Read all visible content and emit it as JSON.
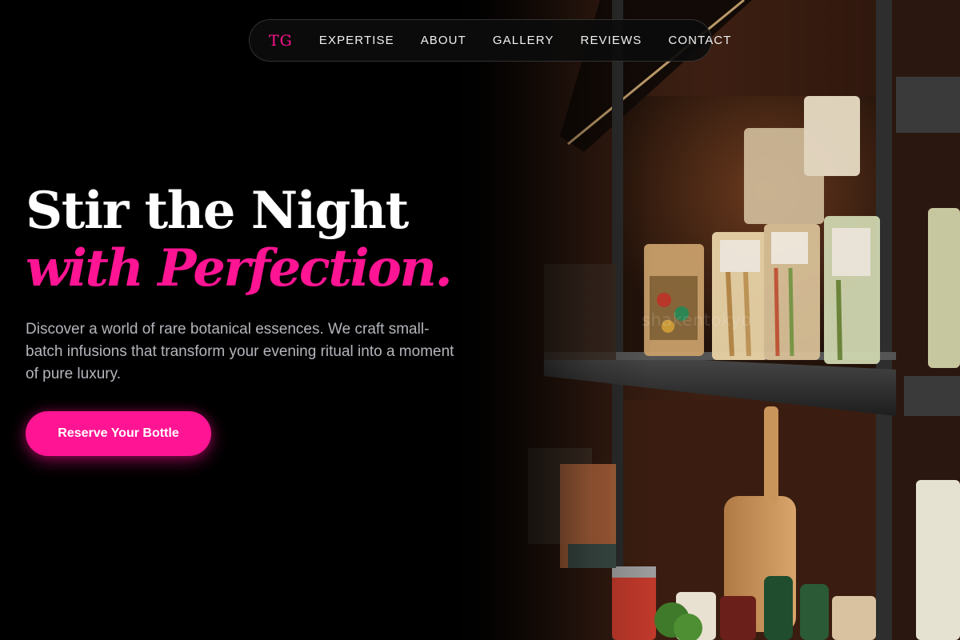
{
  "nav": {
    "logo": "TG",
    "items": [
      {
        "label": "EXPERTISE"
      },
      {
        "label": "ABOUT"
      },
      {
        "label": "GALLERY"
      },
      {
        "label": "REVIEWS"
      },
      {
        "label": "CONTACT"
      }
    ]
  },
  "hero": {
    "headline_line1": "Stir the Night",
    "headline_line2": "with Perfection.",
    "description": "Discover a world of rare botanical essences. We craft small-batch infusions that transform your evening ritual into a moment of pure luxury.",
    "cta_label": "Reserve Your Bottle",
    "photo_watermark": "shakentokyo"
  },
  "colors": {
    "accent": "#ff1493",
    "background": "#000000",
    "text_primary": "#ffffff",
    "text_muted": "#b4b6bc"
  }
}
